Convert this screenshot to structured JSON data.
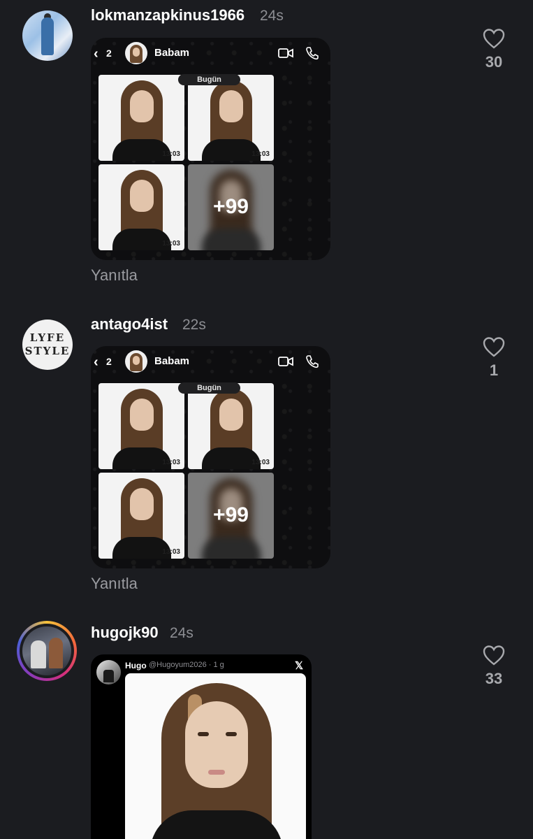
{
  "comments": [
    {
      "username": "lokmanzapkinus1966",
      "time": "24s",
      "likes": "30",
      "reply": "Yanıtla",
      "chat": {
        "back_count": "2",
        "contact": "Babam",
        "date_badge": "Bugün",
        "timestamps": [
          "13:03",
          "13:03",
          "13:03"
        ],
        "more": "+99",
        "icons": [
          "back-chevron-icon",
          "video-call-icon",
          "phone-icon"
        ]
      }
    },
    {
      "username": "antago4ist",
      "time": "22s",
      "likes": "1",
      "reply": "Yanıtla",
      "avatar_text": [
        "LYFE",
        "STYLE"
      ],
      "chat": {
        "back_count": "2",
        "contact": "Babam",
        "date_badge": "Bugün",
        "timestamps": [
          "13:03",
          "13:03",
          "13:03"
        ],
        "more": "+99",
        "icons": [
          "back-chevron-icon",
          "video-call-icon",
          "phone-icon"
        ]
      }
    },
    {
      "username": "hugojk90",
      "time": "24s",
      "likes": "33",
      "tweet": {
        "name": "Hugo",
        "handle_time": "@Hugoyum2026 · 1 g",
        "logo": "𝕏"
      }
    }
  ],
  "colors": {
    "background": "#1b1c20",
    "username": "#ffffff",
    "time": "#8d8e93",
    "like_count": "#a8a9ad",
    "reply": "#9a9ba0"
  },
  "icons": [
    "heart-icon"
  ]
}
